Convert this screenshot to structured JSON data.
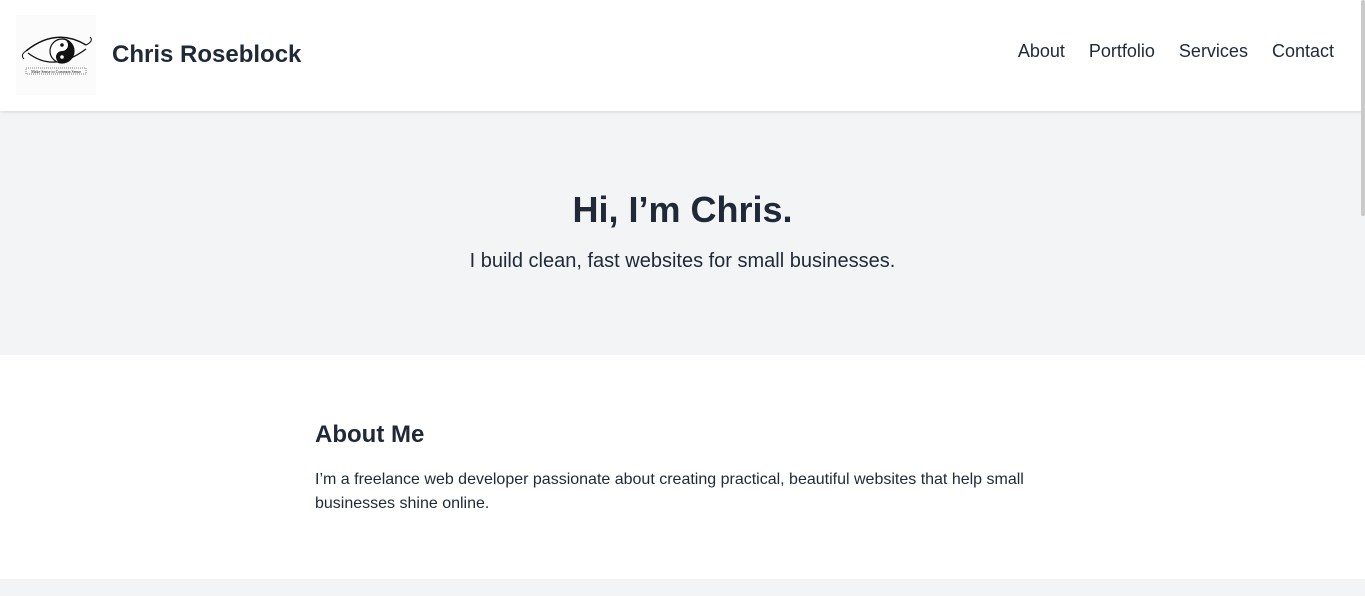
{
  "header": {
    "brand": "Chris Roseblock",
    "logo_icon": "yin-yang-eye-logo",
    "logo_text": "Make Sense to Common Sense",
    "nav": [
      {
        "label": "About"
      },
      {
        "label": "Portfolio"
      },
      {
        "label": "Services"
      },
      {
        "label": "Contact"
      }
    ]
  },
  "hero": {
    "title": "Hi, I’m Chris.",
    "subtitle": "I build clean, fast websites for small businesses."
  },
  "about": {
    "heading": "About Me",
    "body": "I’m a freelance web developer passionate about creating practical, beautiful websites that help small businesses shine online."
  },
  "colors": {
    "text": "#1f2937",
    "hero_bg": "#f3f4f6",
    "page_bg": "#ffffff"
  }
}
